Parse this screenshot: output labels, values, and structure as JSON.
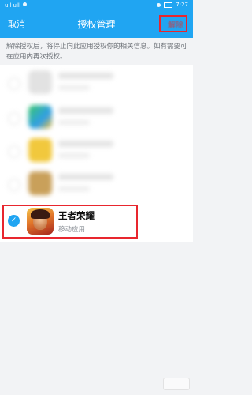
{
  "status_bar": {
    "time": "7:27",
    "signal_text": "ull ull"
  },
  "header": {
    "cancel_label": "取消",
    "title": "授权管理",
    "unbind_label": "解除"
  },
  "notice": "解除授权后，将停止向此应用授权你的相关信息。如有需要可在应用内再次授权。",
  "selected_app": {
    "name": "王者荣耀",
    "type": "移动应用",
    "checked": true
  },
  "colors": {
    "header_bg": "#20a5f2",
    "highlight_border": "#e8262e",
    "check_bg": "#20a5f2"
  },
  "icons": [
    "check-icon",
    "wifi-icon",
    "signal-icon",
    "alarm-icon",
    "battery-icon"
  ]
}
